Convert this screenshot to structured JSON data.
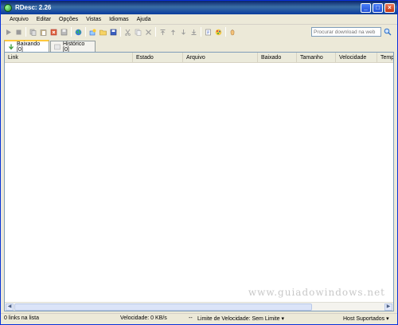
{
  "window": {
    "title": "RDesc: 2.26"
  },
  "menu": [
    "Arquivo",
    "Editar",
    "Opções",
    "Vistas",
    "Idiomas",
    "Ajuda"
  ],
  "toolbar": {
    "icons": [
      "play-icon",
      "stop-icon",
      "copy-icon",
      "paste-icon",
      "delete-icon",
      "disk-icon",
      "globe-icon",
      "add-link-icon",
      "open-folder-icon",
      "save-icon",
      "cut-icon",
      "copy2-icon",
      "remove-icon",
      "move-top-icon",
      "move-up-icon",
      "move-down-icon",
      "move-bottom-icon",
      "notes-icon",
      "palette-icon",
      "hand-icon"
    ],
    "search_placeholder": "Procurar download na web"
  },
  "tabs": [
    {
      "label": "Baixando [0]",
      "active": true
    },
    {
      "label": "Histórico [0]",
      "active": false
    }
  ],
  "columns": [
    "Link",
    "Estado",
    "Arquivo",
    "Baixado",
    "Tamanho",
    "Velocidade",
    "Tempo"
  ],
  "watermark": "www.guiadowindows.net",
  "status": {
    "links": "0 links na lista",
    "speed": "Velocidade: 0 KB/s",
    "sep": "--",
    "limit": "Limite de Velocidade: Sem Limite",
    "hosts": "Host Suportados"
  }
}
